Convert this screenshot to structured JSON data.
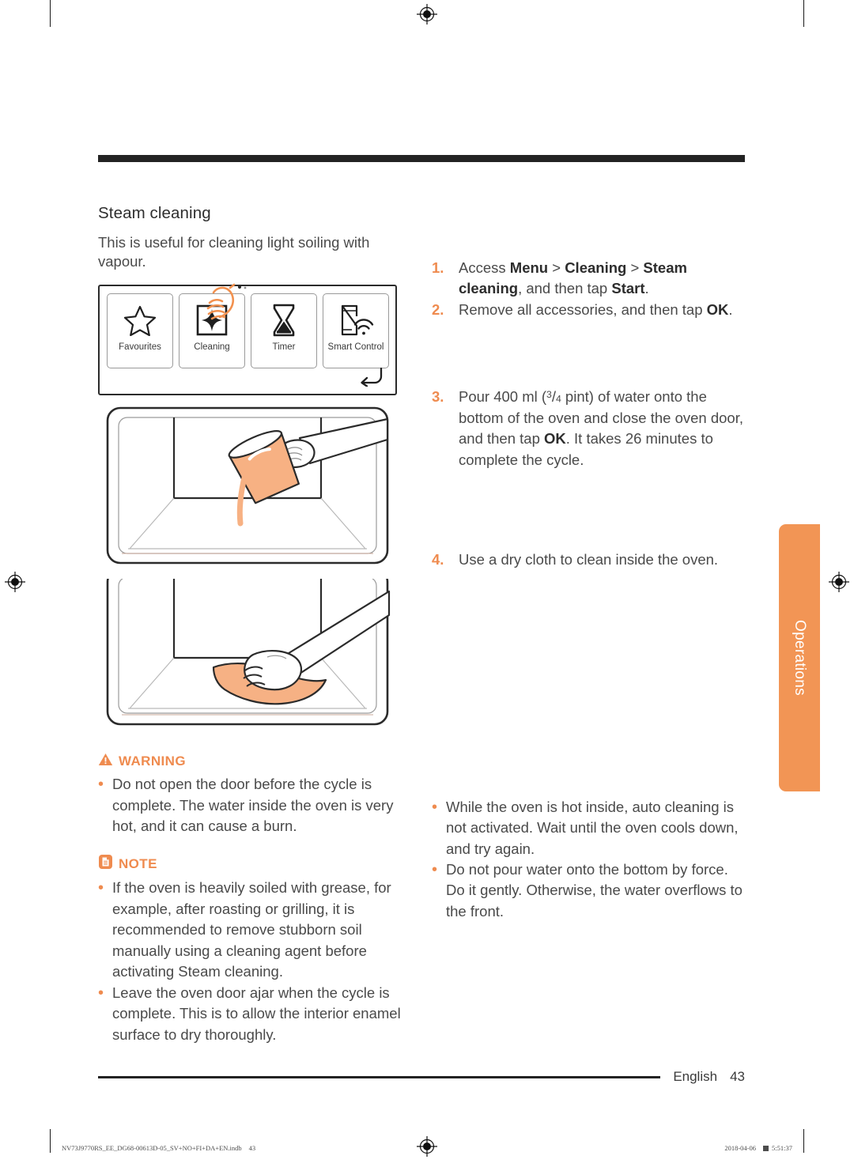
{
  "document": {
    "section_title": "Steam cleaning",
    "intro": "This is useful for cleaning light soiling with vapour."
  },
  "control_panel": {
    "tiles": [
      {
        "label": "Favourites",
        "icon": "star-icon"
      },
      {
        "label": "Cleaning",
        "icon": "sparkle-icon"
      },
      {
        "label": "Timer",
        "icon": "hourglass-icon"
      },
      {
        "label": "Smart\nControl",
        "icon": "smart-control-icon"
      }
    ],
    "back_icon": "back-arrow-icon",
    "hand_icon": "tap-hand-icon"
  },
  "illustrations": {
    "pour": "hand-pouring-water-into-oven",
    "wipe": "hand-wiping-oven-with-cloth"
  },
  "steps": [
    {
      "number": "1.",
      "parts": [
        {
          "t": "Access ",
          "b": false
        },
        {
          "t": "Menu",
          "b": true
        },
        {
          "t": " > ",
          "b": false
        },
        {
          "t": "Cleaning",
          "b": true
        },
        {
          "t": " > ",
          "b": false
        },
        {
          "t": "Steam cleaning",
          "b": true
        },
        {
          "t": ", and then tap ",
          "b": false
        },
        {
          "t": "Start",
          "b": true
        },
        {
          "t": ".",
          "b": false
        }
      ]
    },
    {
      "number": "2.",
      "parts": [
        {
          "t": "Remove all accessories, and then tap ",
          "b": false
        },
        {
          "t": "OK",
          "b": true
        },
        {
          "t": ".",
          "b": false
        }
      ]
    },
    {
      "number": "3.",
      "parts": [
        {
          "t": "Pour 400 ml (",
          "b": false
        },
        {
          "t": "3/4",
          "b": false,
          "fraction": true
        },
        {
          "t": " pint) of water onto the bottom of the oven and close the oven door, and then tap ",
          "b": false
        },
        {
          "t": "OK",
          "b": true
        },
        {
          "t": ". It takes 26 minutes to complete the cycle.",
          "b": false
        }
      ]
    },
    {
      "number": "4.",
      "parts": [
        {
          "t": "Use a dry cloth to clean inside the oven.",
          "b": false
        }
      ]
    }
  ],
  "warning": {
    "icon": "warning-triangle-icon",
    "title": "WARNING",
    "bullets": [
      "Do not open the door before the cycle is complete. The water inside the oven is very hot, and it can cause a burn."
    ]
  },
  "note_left": {
    "icon": "note-document-icon",
    "title": "NOTE",
    "bullets": [
      "If the oven is heavily soiled with grease, for example, after roasting or grilling, it is recommended to remove stubborn soil manually using a cleaning agent before activating Steam cleaning.",
      "Leave the oven door ajar when the cycle is complete. This is to allow the interior enamel surface to dry thoroughly."
    ]
  },
  "note_right": {
    "bullets": [
      "While the oven is hot inside, auto cleaning is not activated. Wait until the oven cools down, and try again.",
      "Do not pour water onto the bottom by force. Do it gently. Otherwise, the water overflows to the front."
    ]
  },
  "side_tab": {
    "label": "Operations",
    "color": "#f29555"
  },
  "footer": {
    "language": "English",
    "page": "43"
  },
  "production": {
    "filename": "NV73J9770RS_EE_DG68-00613D-05_SV+NO+FI+DA+EN.indb",
    "page": "43",
    "date": "2018-04-06",
    "time": "5:51:37"
  }
}
